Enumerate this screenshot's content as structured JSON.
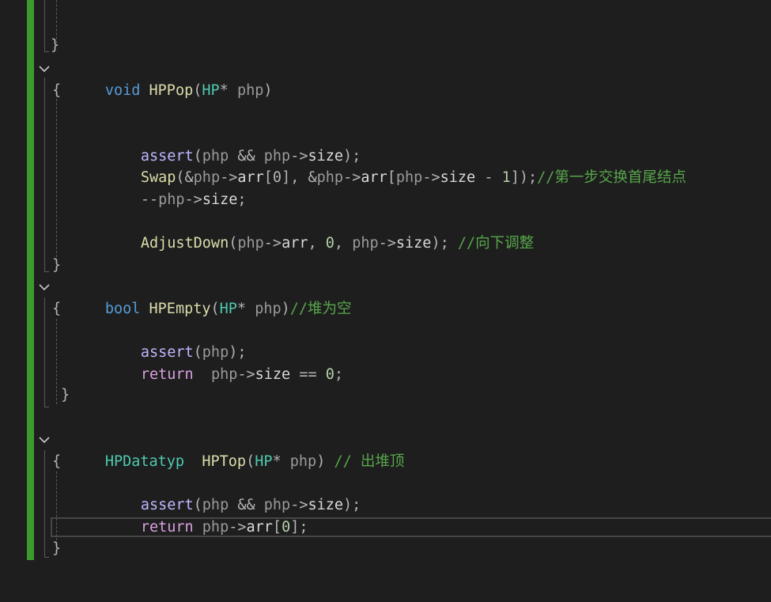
{
  "editor": {
    "colors": {
      "background": "#1e1e1e",
      "change_bar": "#3c9b2a",
      "keyword": "#569cd6",
      "function": "#dcdcaa",
      "type": "#4ec9b0",
      "comment": "#57a64a",
      "control_keyword": "#d8a0df",
      "macro": "#beb7ff"
    },
    "fold_icon": "chevron-down-icon",
    "lines": {
      "l1_close": "}",
      "hppop_kw": "void",
      "hppop_name": "HPPop",
      "hppop_open": "(",
      "hppop_type": "HP",
      "hppop_star": "*",
      "hppop_param": "php",
      "hppop_close": ")",
      "hppop_brace_open": "{",
      "assert1_fn": "assert",
      "assert1_args_a": "(",
      "assert1_php1": "php",
      "assert1_and": "&&",
      "assert1_php2": "php",
      "assert1_arrow": "->",
      "assert1_size": "size",
      "assert1_end": ");",
      "swap_fn": "Swap",
      "swap_p1": "(&",
      "swap_php1": "php",
      "swap_arrow1": "->",
      "swap_arr1": "arr",
      "swap_idx1": "[0],",
      "swap_amp2": "&",
      "swap_php2": "php",
      "swap_arrow2": "->",
      "swap_arr2": "arr",
      "swap_br": "[",
      "swap_php3": "php",
      "swap_arrow3": "->",
      "swap_size": "size",
      "swap_minus": "-",
      "swap_one": "1",
      "swap_end": "]);",
      "swap_comment": "//第一步交换首尾结点",
      "dec_op": "--",
      "dec_php": "php",
      "dec_arrow": "->",
      "dec_size": "size",
      "dec_end": ";",
      "adj_fn": "AdjustDown",
      "adj_open": "(",
      "adj_php1": "php",
      "adj_arrow1": "->",
      "adj_arr": "arr",
      "adj_comma": ",",
      "adj_zero": "0",
      "adj_comma2": ",",
      "adj_php2": "php",
      "adj_arrow2": "->",
      "adj_size": "size",
      "adj_end": ");",
      "adj_comment": "//向下调整",
      "hppop_brace_close": "}",
      "empty_kw": "bool",
      "empty_name": "HPEmpty",
      "empty_open": "(",
      "empty_type": "HP",
      "empty_star": "*",
      "empty_param": "php",
      "empty_close": ")",
      "empty_comment": "//堆为空",
      "empty_brace_open": "{",
      "assert2_fn": "assert",
      "assert2_open": "(",
      "assert2_php": "php",
      "assert2_end": ");",
      "ret1_kw": "return",
      "ret1_php": "php",
      "ret1_arrow": "->",
      "ret1_size": "size",
      "ret1_eq": "==",
      "ret1_zero": "0",
      "ret1_end": ";",
      "empty_brace_close": "}",
      "top_type": "HPDatatyp",
      "top_name": "HPTop",
      "top_open": "(",
      "top_ptype": "HP",
      "top_star": "*",
      "top_param": "php",
      "top_close": ")",
      "top_comment": "// 出堆顶",
      "top_brace_open": "{",
      "assert3_fn": "assert",
      "assert3_open": "(",
      "assert3_php1": "php",
      "assert3_and": "&&",
      "assert3_php2": "php",
      "assert3_arrow": "->",
      "assert3_size": "size",
      "assert3_end": ");",
      "ret2_kw": "return",
      "ret2_php": "php",
      "ret2_arrow": "->",
      "ret2_arr": "arr",
      "ret2_idx_open": "[",
      "ret2_zero": "0",
      "ret2_end": "];",
      "top_brace_close": "}"
    }
  }
}
